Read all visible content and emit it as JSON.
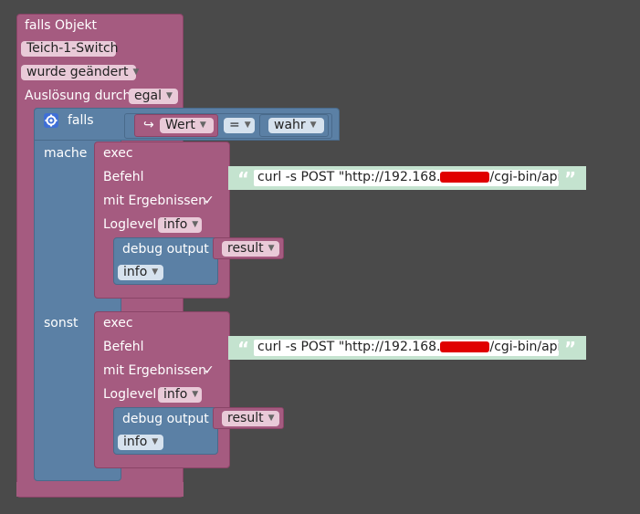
{
  "trigger": {
    "title": "falls Objekt",
    "object_name": "Teich-1-Switch",
    "event": "wurde geändert",
    "trigger_by_label": "Auslösung durch",
    "trigger_by_value": "egal"
  },
  "if_block": {
    "label": "falls",
    "var_value": "Wert",
    "operator": "=",
    "compare_value": "wahr",
    "then_label": "mache",
    "else_label": "sonst"
  },
  "exec_then": {
    "title": "exec",
    "command_label": "Befehl",
    "command_prefix": "curl -s POST \"http://192.168.",
    "command_suffix": "/cgi-bin/api…",
    "with_results_label": "mit Ergebnissen",
    "with_results_check": "✓",
    "loglevel_label": "Loglevel",
    "loglevel_value": "info",
    "debug_label": "debug output",
    "debug_value": "result",
    "debug_level": "info"
  },
  "exec_else": {
    "title": "exec",
    "command_label": "Befehl",
    "command_prefix": "curl -s POST \"http://192.168.",
    "command_suffix": "/cgi-bin/api…",
    "with_results_label": "mit Ergebnissen",
    "with_results_check": "✓",
    "loglevel_label": "Loglevel",
    "loglevel_value": "info",
    "debug_label": "debug output",
    "debug_value": "result",
    "debug_level": "info"
  },
  "colors": {
    "background": "#4a4a4a",
    "trigger_block": "#a55b80",
    "logic_block": "#5b80a5",
    "text_block": "#c4e3cf",
    "redaction": "#e00000"
  }
}
